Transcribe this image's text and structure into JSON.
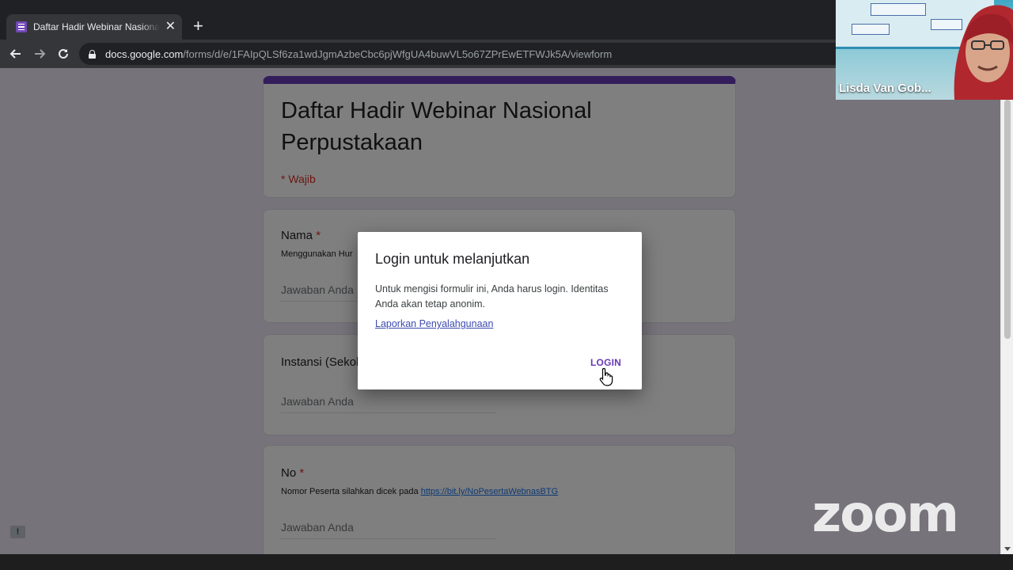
{
  "browser": {
    "tab": {
      "title": "Daftar Hadir Webinar Nasional Perpustakaan"
    },
    "url": {
      "host": "docs.google.com",
      "path": "/forms/d/e/1FAIpQLSf6za1wdJgmAzbeCbc6pjWfgUA4buwVL5o67ZPrEwETFWJk5A/viewform"
    }
  },
  "form": {
    "title": "Daftar Hadir Webinar Nasional Perpustakaan",
    "required_note": "* Wajib",
    "questions": [
      {
        "label": "Nama",
        "required": "*",
        "help": "Menggunakan Hur",
        "answer_placeholder": "Jawaban Anda"
      },
      {
        "label": "Instansi (Sekol",
        "answer_placeholder": "Jawaban Anda"
      },
      {
        "label": "No",
        "required": "*",
        "help": "Nomor Peserta silahkan dicek pada",
        "help_link": "https://bit.ly/NoPesertaWebnasBTG",
        "answer_placeholder": "Jawaban Anda"
      }
    ]
  },
  "dialog": {
    "title": "Login untuk melanjutkan",
    "body": "Untuk mengisi formulir ini, Anda harus login. Identitas Anda akan tetap anonim.",
    "link": "Laporkan Penyalahgunaan",
    "button": "LOGIN"
  },
  "zoom": {
    "participant_name": "Lisda Van Gob...",
    "logo": "zoom"
  },
  "colors": {
    "accent": "#673ab7",
    "required": "#d93025",
    "link": "#3c4ab1"
  }
}
